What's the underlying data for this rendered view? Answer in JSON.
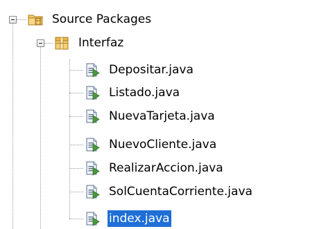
{
  "tree": {
    "root": {
      "label": "Source Packages",
      "icon": "source-packages-icon",
      "expanded": true
    },
    "package": {
      "label": "Interfaz",
      "icon": "package-icon",
      "expanded": true
    },
    "files": [
      {
        "label": "Depositar.java",
        "icon": "java-file-icon"
      },
      {
        "label": "Listado.java",
        "icon": "java-file-icon"
      },
      {
        "label": "NuevaTarjeta.java",
        "icon": "java-file-icon"
      },
      {
        "label": "NuevoCliente.java",
        "icon": "java-file-icon"
      },
      {
        "label": "RealizarAccion.java",
        "icon": "java-file-icon"
      },
      {
        "label": "SolCuentaCorriente.java",
        "icon": "java-file-icon"
      },
      {
        "label": "index.java",
        "icon": "java-file-icon",
        "selected": true
      }
    ]
  },
  "colors": {
    "selection": "#1f6fd6",
    "folder": "#e8b84a",
    "package": "#e9b54c",
    "java_file": "#4a9a3c"
  }
}
